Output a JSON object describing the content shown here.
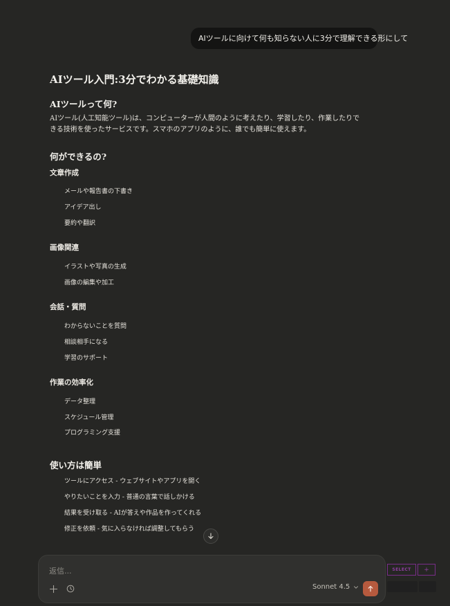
{
  "user_message": "AIツールに向けて何も知らない人に3分で理解できる形にして",
  "response": {
    "title": "AIツール入門:3分でわかる基礎知識",
    "section1": {
      "heading": "AIツールって何?",
      "paragraph": "AIツール(人工知能ツール)は、コンピューターが人間のように考えたり、学習したり、作業したりできる技術を使ったサービスです。スマホのアプリのように、誰でも簡単に使えます。"
    },
    "section2": {
      "heading": "何ができるの?",
      "groups": [
        {
          "title": "文章作成",
          "items": [
            "メールや報告書の下書き",
            "アイデア出し",
            "要約や翻訳"
          ]
        },
        {
          "title": "画像関連",
          "items": [
            "イラストや写真の生成",
            "画像の編集や加工"
          ]
        },
        {
          "title": "会話・質問",
          "items": [
            "わからないことを質問",
            "相談相手になる",
            "学習のサポート"
          ]
        },
        {
          "title": "作業の効率化",
          "items": [
            "データ整理",
            "スケジュール管理",
            "プログラミング支援"
          ]
        }
      ]
    },
    "section3": {
      "heading": "使い方は簡単",
      "steps": [
        "ツールにアクセス - ウェブサイトやアプリを開く",
        "やりたいことを入力 - 普通の言葉で話しかける",
        "結果を受け取る - AIが答えや作品を作ってくれる",
        "修正を依頼 - 気に入らなければ調整してもらう"
      ]
    }
  },
  "composer": {
    "placeholder": "返信...",
    "model_label": "Sonnet 4.5"
  },
  "overlay": {
    "select_label": "SELECT",
    "plus_label": "+"
  },
  "icons": {
    "add": "plus-icon",
    "history": "clock-icon",
    "model_dropdown": "chevron-down-icon",
    "send": "arrow-up-icon",
    "scroll": "arrow-down-icon"
  },
  "colors": {
    "background": "#262624",
    "send_button": "#b65a3e",
    "select_accent": "#8e3da0"
  }
}
